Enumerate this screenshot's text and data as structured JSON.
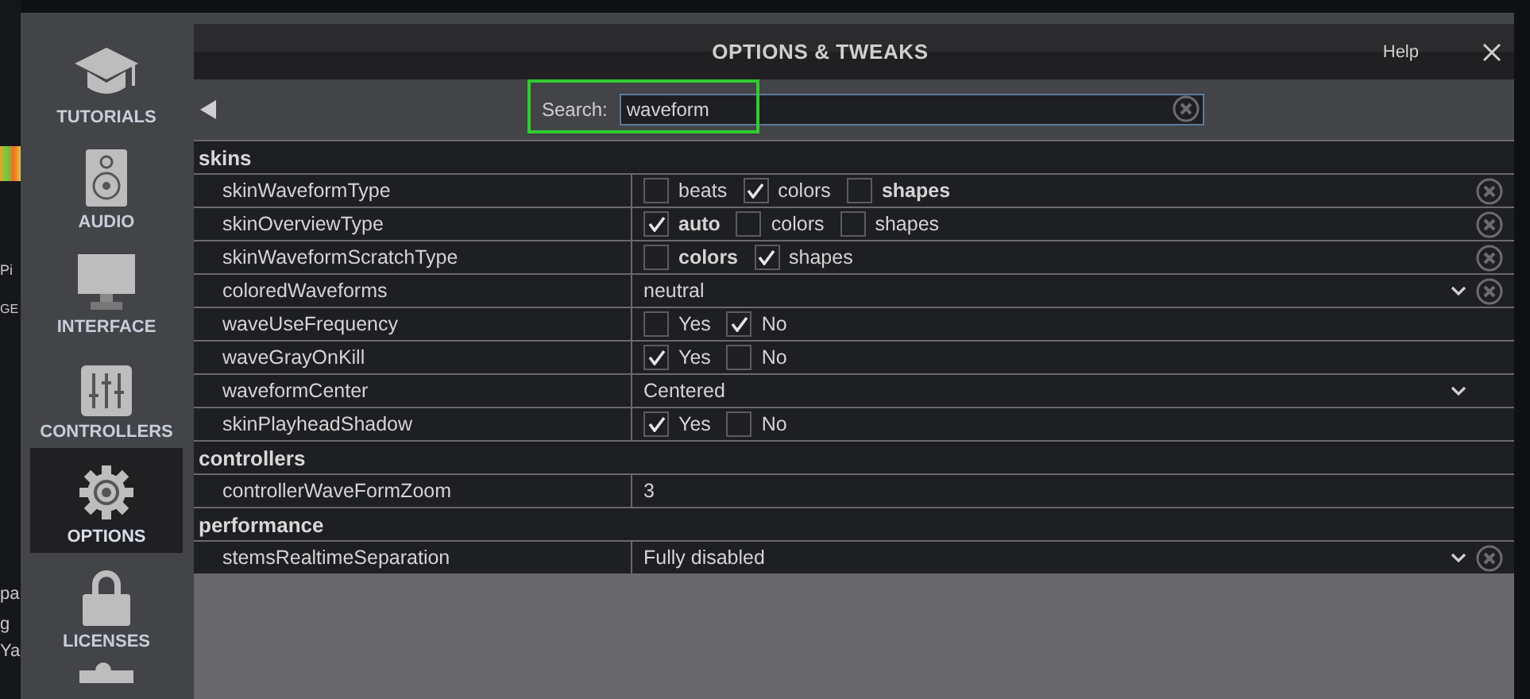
{
  "background_fragments": [
    "Pi",
    "GE",
    "pa",
    "g",
    "Ya"
  ],
  "sidebar": {
    "items": [
      {
        "label": "TUTORIALS",
        "kind": "cap",
        "selected": false
      },
      {
        "label": "AUDIO",
        "kind": "speaker",
        "selected": false
      },
      {
        "label": "INTERFACE",
        "kind": "monitor",
        "selected": false
      },
      {
        "label": "CONTROLLERS",
        "kind": "sliders",
        "selected": false
      },
      {
        "label": "OPTIONS",
        "kind": "gear",
        "selected": true
      },
      {
        "label": "LICENSES",
        "kind": "lock",
        "selected": false
      }
    ]
  },
  "window": {
    "title": "OPTIONS & TWEAKS",
    "help": "Help"
  },
  "search": {
    "label": "Search:",
    "value": "waveform",
    "highlighted": true
  },
  "sections": [
    {
      "title": "skins",
      "rows": [
        {
          "name": "skinWaveformType",
          "kind": "checks",
          "resettable": true,
          "options": [
            {
              "label": "beats",
              "checked": false,
              "bold": false
            },
            {
              "label": "colors",
              "checked": true,
              "bold": false
            },
            {
              "label": "shapes",
              "checked": false,
              "bold": true
            }
          ]
        },
        {
          "name": "skinOverviewType",
          "kind": "checks",
          "resettable": true,
          "options": [
            {
              "label": "auto",
              "checked": true,
              "bold": true
            },
            {
              "label": "colors",
              "checked": false,
              "bold": false
            },
            {
              "label": "shapes",
              "checked": false,
              "bold": false
            }
          ]
        },
        {
          "name": "skinWaveformScratchType",
          "kind": "checks",
          "resettable": true,
          "options": [
            {
              "label": "colors",
              "checked": false,
              "bold": true
            },
            {
              "label": "shapes",
              "checked": true,
              "bold": false
            }
          ]
        },
        {
          "name": "coloredWaveforms",
          "kind": "select",
          "resettable": true,
          "value": "neutral"
        },
        {
          "name": "waveUseFrequency",
          "kind": "checks",
          "resettable": false,
          "options": [
            {
              "label": "Yes",
              "checked": false,
              "bold": false
            },
            {
              "label": "No",
              "checked": true,
              "bold": false
            }
          ]
        },
        {
          "name": "waveGrayOnKill",
          "kind": "checks",
          "resettable": false,
          "options": [
            {
              "label": "Yes",
              "checked": true,
              "bold": false
            },
            {
              "label": "No",
              "checked": false,
              "bold": false
            }
          ]
        },
        {
          "name": "waveformCenter",
          "kind": "select",
          "resettable": false,
          "value": "Centered"
        },
        {
          "name": "skinPlayheadShadow",
          "kind": "checks",
          "resettable": false,
          "options": [
            {
              "label": "Yes",
              "checked": true,
              "bold": false
            },
            {
              "label": "No",
              "checked": false,
              "bold": false
            }
          ]
        }
      ]
    },
    {
      "title": "controllers",
      "rows": [
        {
          "name": "controllerWaveFormZoom",
          "kind": "text",
          "resettable": false,
          "value": "3"
        }
      ]
    },
    {
      "title": "performance",
      "rows": [
        {
          "name": "stemsRealtimeSeparation",
          "kind": "select",
          "resettable": true,
          "value": "Fully disabled"
        }
      ]
    }
  ]
}
